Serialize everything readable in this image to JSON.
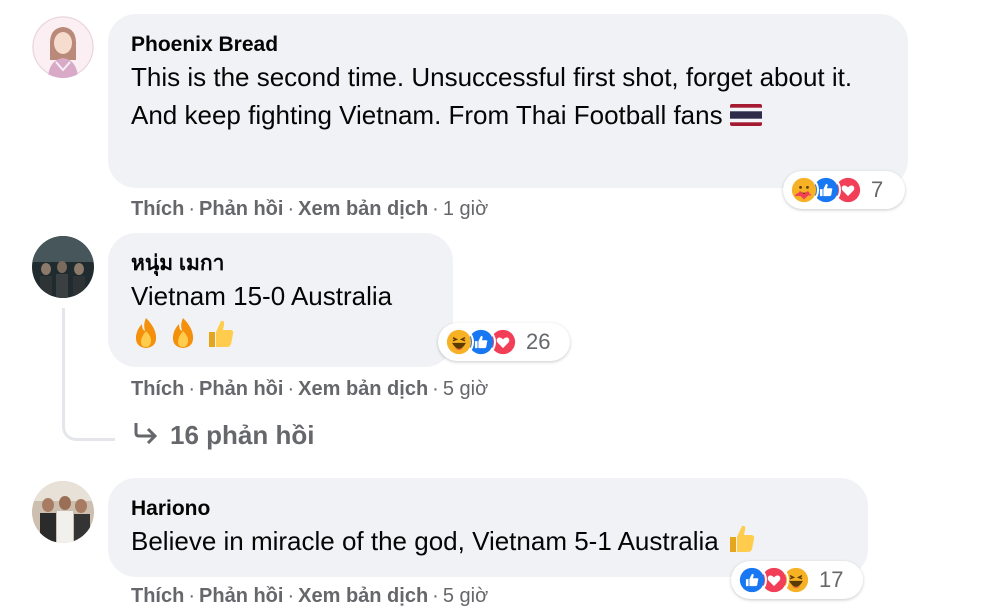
{
  "comments": [
    {
      "author": "Phoenix Bread",
      "text": "This is the second time. Unsuccessful first shot, forget about it. And keep fighting Vietnam. From Thai Football fans",
      "flag_emoji": "🇹🇭",
      "actions": {
        "like": "Thích",
        "reply": "Phản hồi",
        "translate": "Xem bản dịch",
        "time": "1 giờ"
      },
      "reactions": {
        "icons": [
          "care",
          "like",
          "love"
        ],
        "count": "7"
      }
    },
    {
      "author": "หนุ่ม เมกา",
      "text": "Vietnam 15-0 Australia",
      "emoji_line": [
        "fire",
        "fire",
        "thumbs-up"
      ],
      "actions": {
        "like": "Thích",
        "reply": "Phản hồi",
        "translate": "Xem bản dịch",
        "time": "5 giờ"
      },
      "reactions": {
        "icons": [
          "haha",
          "like",
          "love"
        ],
        "count": "26"
      },
      "replies_label": "16 phản hồi"
    },
    {
      "author": "Hariono",
      "text": "Believe in miracle of the god, Vietnam 5-1 Australia",
      "actions": {
        "like": "Thích",
        "reply": "Phản hồi",
        "translate": "Xem bản dịch",
        "time": "5 giờ"
      },
      "reactions": {
        "icons": [
          "like",
          "love",
          "haha"
        ],
        "count": "17"
      }
    }
  ],
  "colors": {
    "bubble": "#f0f2f5",
    "secondary_text": "#65676b",
    "like_blue": "#1877f2",
    "love_red": "#f33e58",
    "haha_yellow": "#f7b125"
  }
}
